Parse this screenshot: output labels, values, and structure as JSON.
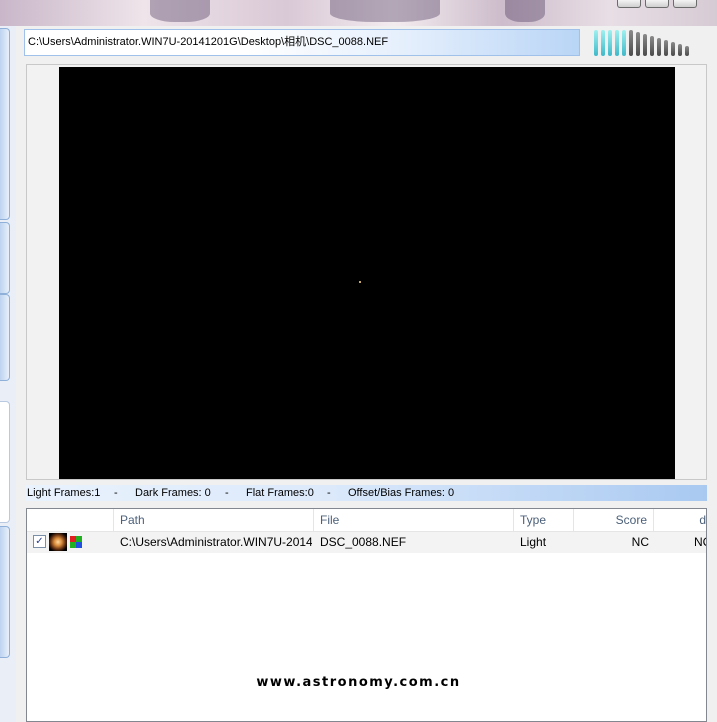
{
  "file_path": "C:\\Users\\Administrator.WIN7U-20141201G\\Desktop\\相机\\DSC_0088.NEF",
  "frames_bar": {
    "light": "Light Frames:1",
    "sep1": "-",
    "dark": "Dark Frames: 0",
    "sep2": "-",
    "flat": "Flat Frames:0",
    "sep3": "-",
    "offset": "Offset/Bias Frames: 0"
  },
  "file_list": {
    "columns": [
      "Path",
      "File",
      "Type",
      "Score",
      "d"
    ],
    "rows": [
      {
        "checked": "✓",
        "path": "C:\\Users\\Administrator.WIN7U-20141...",
        "file": "DSC_0088.NEF",
        "type": "Light",
        "score": "NC",
        "d": "NC"
      }
    ]
  },
  "watermark": "www.astronomy.com.cn",
  "icons": {
    "thumbnail": "star-thumbnail-icon",
    "bayer": "bayer-pattern-icon"
  },
  "colors": {
    "accent": "#a9c9f1",
    "header_text": "#4c607a"
  }
}
